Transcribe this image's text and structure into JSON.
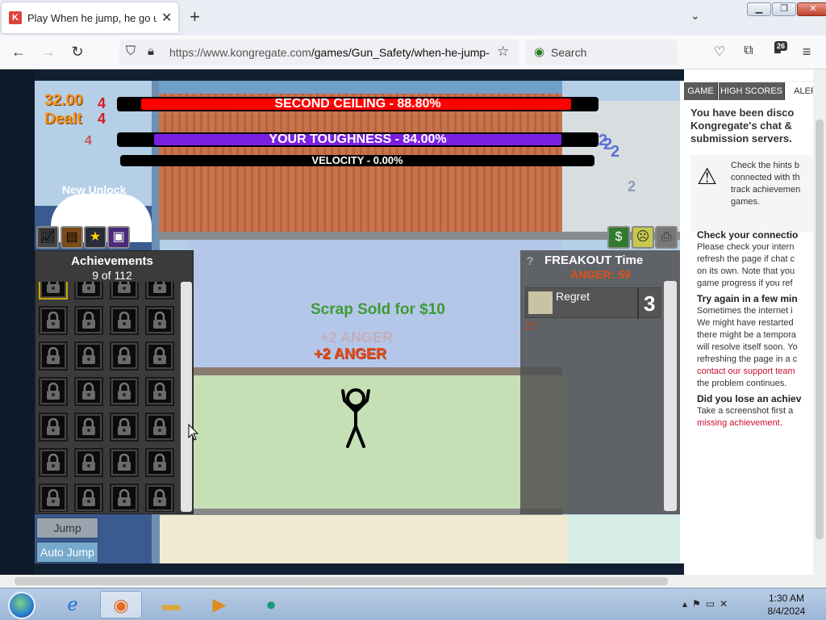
{
  "browser": {
    "tab_title": "Play When he jump, he go up h",
    "tab_favicon": "K",
    "url_host": "https://www.kongregate.com",
    "url_path": "/games/Gun_Safety/when-he-jump-",
    "search_placeholder": "Search",
    "extensions_badge": "26"
  },
  "game": {
    "dealt_value": "32.00",
    "dealt_label": "Dealt",
    "bar_ceiling": "SECOND CEILING - 88.80%",
    "bar_ceiling_fill": 0.888,
    "bar_toughness": "YOUR TOUGHNESS - 84.00%",
    "bar_toughness_fill": 0.84,
    "bar_velocity": "VELOCITY - 0.00%",
    "bar_velocity_fill": 0.0,
    "new_unlock": "New Unlock",
    "float_numbers": [
      "4",
      "4",
      "4",
      "2",
      "2",
      "2",
      "2"
    ],
    "achievements": {
      "title": "Achievements",
      "count": "9 of 112"
    },
    "freakout": {
      "help": "?",
      "title": "FREAKOUT Time",
      "anger": "ANGER: 59",
      "item_name": "Regret",
      "item_count": "3",
      "timer": "27"
    },
    "fx_scrap": "Scrap Sold for $10",
    "fx_anger_ghost": "+2 ANGER",
    "fx_anger": "+2 ANGER",
    "buttons": {
      "jump": "Jump",
      "auto_jump": "Auto Jump"
    },
    "colors": {
      "ceiling": "#ff0000",
      "toughness": "#7a1fe0",
      "dealt": "#f7941d"
    }
  },
  "kongregate": {
    "tabs": [
      "GAME",
      "HIGH SCORES",
      "ALER"
    ],
    "title_lines": [
      "You have been disco",
      "Kongregate's chat &",
      "submission servers."
    ],
    "warning_lines": [
      "Check the hints b",
      "connected with th",
      "track achievemen",
      "games."
    ],
    "sections": [
      {
        "heading": "Check your connectio",
        "lines": [
          "Please check your intern",
          "refresh the page if chat c",
          "on its own. Note that you",
          "game progress if you ref"
        ]
      },
      {
        "heading": "Try again in a few min",
        "lines": [
          "Sometimes the internet i",
          "We might have restarted",
          "there might be a tempora",
          "will resolve itself soon. Yo",
          "refreshing the page in a c"
        ],
        "link": "contact our support team",
        "after": "the problem continues."
      },
      {
        "heading": "Did you lose an achiev",
        "lines": [
          "Take a screenshot first a"
        ],
        "link": "missing achievement."
      }
    ]
  },
  "taskbar": {
    "time": "1:30 AM",
    "date": "8/4/2024"
  }
}
